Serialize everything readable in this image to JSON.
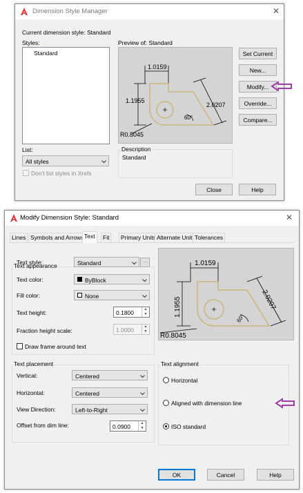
{
  "dsm": {
    "title": "Dimension Style Manager",
    "current_style_label": "Current dimension style: Standard",
    "styles_label": "Styles:",
    "styles": [
      "Standard"
    ],
    "preview_label": "Preview of: Standard",
    "buttons": {
      "set_current": "Set Current",
      "new": "New...",
      "modify": "Modify...",
      "override": "Override...",
      "compare": "Compare...",
      "close": "Close",
      "help": "Help"
    },
    "list_label": "List:",
    "list_value": "All styles",
    "xrefs_label": "Don't list styles in Xrefs",
    "description_label": "Description",
    "description_value": "Standard",
    "preview_dims": {
      "top": "1.0159",
      "left": "1.1955",
      "right": "2.0207",
      "angle": "60°",
      "radius": "R0.8045"
    }
  },
  "mds": {
    "title": "Modify Dimension Style: Standard",
    "tabs": [
      "Lines",
      "Symbols and Arrows",
      "Text",
      "Fit",
      "Primary Units",
      "Alternate Units",
      "Tolerances"
    ],
    "active_tab": "Text",
    "text_appearance": {
      "title": "Text appearance",
      "text_style_label": "Text style:",
      "text_style_value": "Standard",
      "text_color_label": "Text color:",
      "text_color_value": "ByBlock",
      "fill_color_label": "Fill color:",
      "fill_color_value": "None",
      "text_height_label": "Text height:",
      "text_height_value": "0.1800",
      "fraction_label": "Fraction height scale:",
      "fraction_value": "1.0000",
      "draw_frame_label": "Draw frame around text",
      "ellipsis": "..."
    },
    "text_placement": {
      "title": "Text placement",
      "vertical_label": "Vertical:",
      "vertical_value": "Centered",
      "horizontal_label": "Horizontal:",
      "horizontal_value": "Centered",
      "view_direction_label": "View Direction:",
      "view_direction_value": "Left-to-Right",
      "offset_label": "Offset from dim line:",
      "offset_value": "0.0900"
    },
    "text_alignment": {
      "title": "Text alignment",
      "options": [
        "Horizontal",
        "Aligned with dimension line",
        "ISO standard"
      ],
      "selected": "ISO standard"
    },
    "buttons": {
      "ok": "OK",
      "cancel": "Cancel",
      "help": "Help"
    },
    "preview_dims": {
      "top": "1.0159",
      "left": "1.1955",
      "right": "2.0207",
      "angle": "60°",
      "radius": "R0.8045"
    }
  },
  "colors": {
    "accent": "#0078d7",
    "arrow": "#9b3fa6",
    "brand": "#e03a3e",
    "outline": "#c8b06a"
  }
}
